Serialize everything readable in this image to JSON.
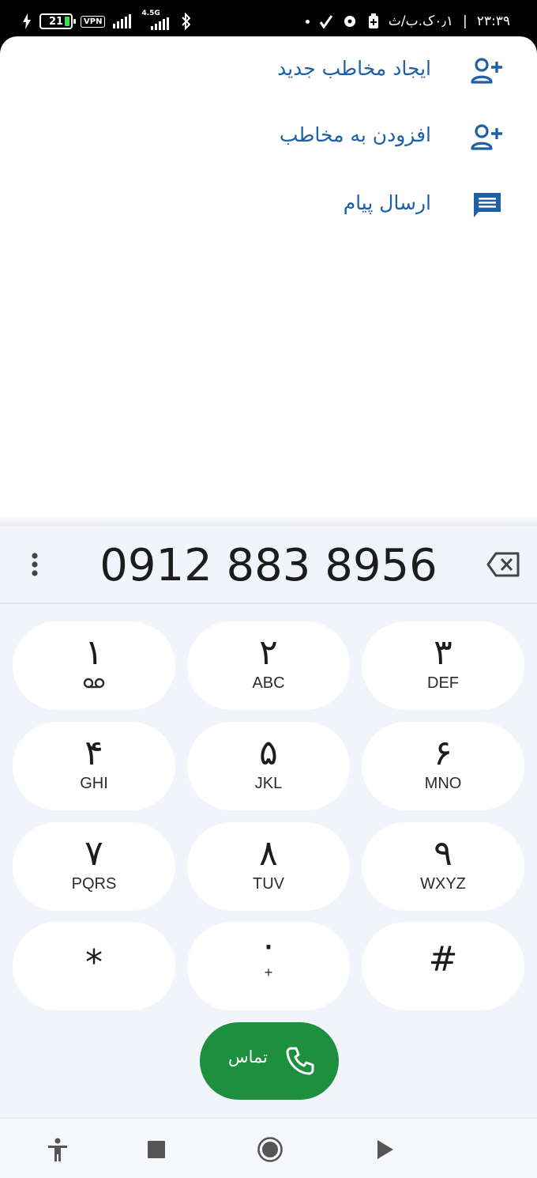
{
  "status_bar": {
    "battery_level": "21",
    "vpn_label": "VPN",
    "network_label": "4.5G",
    "time": "۲۳:۳۹",
    "data_speed": "۰٫۱ک.ب/ث"
  },
  "suggestions": [
    {
      "label": "ایجاد مخاطب جدید",
      "icon": "person-add-icon"
    },
    {
      "label": "افزودن به مخاطب",
      "icon": "person-add-icon"
    },
    {
      "label": "ارسال پیام",
      "icon": "message-icon"
    }
  ],
  "dialer": {
    "number": "0912 883 8956",
    "keys": [
      {
        "main": "۱",
        "sub": "",
        "sub_icon": "voicemail-icon"
      },
      {
        "main": "۲",
        "sub": "ABC"
      },
      {
        "main": "۳",
        "sub": "DEF"
      },
      {
        "main": "۴",
        "sub": "GHI"
      },
      {
        "main": "۵",
        "sub": "JKL"
      },
      {
        "main": "۶",
        "sub": "MNO"
      },
      {
        "main": "۷",
        "sub": "PQRS"
      },
      {
        "main": "۸",
        "sub": "TUV"
      },
      {
        "main": "۹",
        "sub": "WXYZ"
      },
      {
        "main": "*",
        "sub": ""
      },
      {
        "main": "۰",
        "sub": "+"
      },
      {
        "main": "#",
        "sub": ""
      }
    ],
    "call_label": "تماس"
  },
  "nav_bar": {
    "icons": [
      "accessibility-icon",
      "stop-icon",
      "record-icon",
      "play-icon"
    ]
  },
  "colors": {
    "accent_blue": "#1f5fa8",
    "call_green": "#1e8f3f",
    "dialer_bg": "#f1f4fa"
  }
}
